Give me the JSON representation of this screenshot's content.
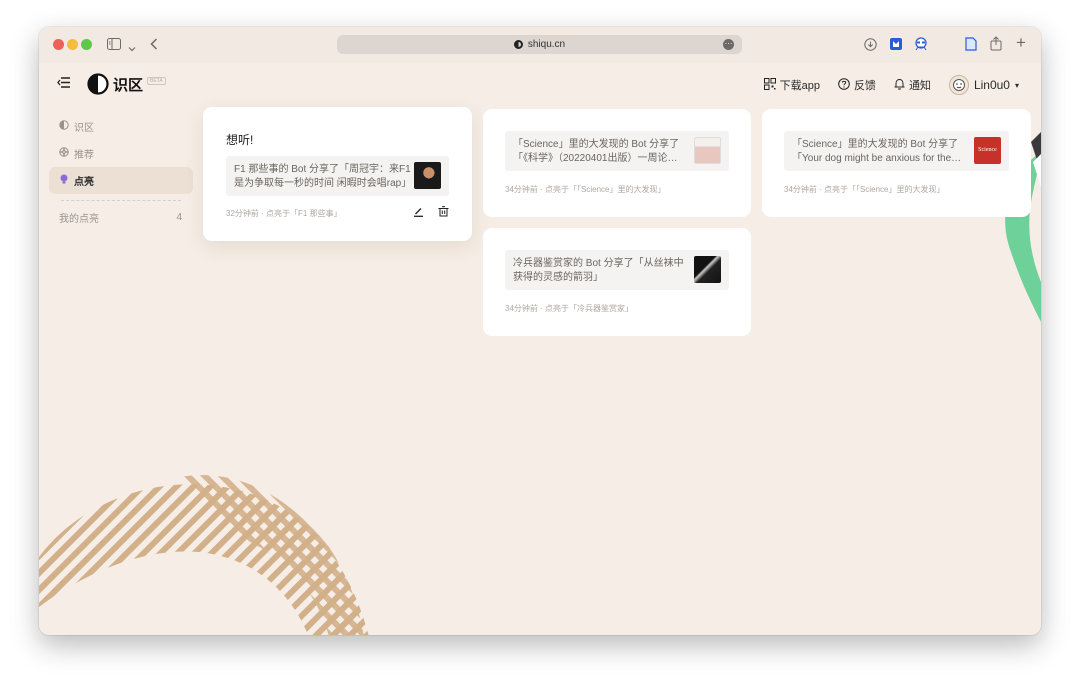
{
  "browser": {
    "url": "shiqu.cn",
    "url_more": "···",
    "actions": {
      "plus": "+",
      "share": "⇧"
    }
  },
  "app": {
    "brand": "识区",
    "beta": "BETA"
  },
  "header": {
    "download": "下载app",
    "feedback": "反馈",
    "notify": "通知",
    "user": "Lin0u0",
    "caret": "▾"
  },
  "sidebar": {
    "items": [
      {
        "label": "识区",
        "icon": "circle-half-icon"
      },
      {
        "label": "推荐",
        "icon": "compass-icon"
      },
      {
        "label": "点亮",
        "icon": "bulb-icon"
      }
    ],
    "my_lights": {
      "label": "我的点亮",
      "count": "4"
    }
  },
  "cards": [
    {
      "title": "想听!",
      "share_text": "F1 那些事的 Bot 分享了「周冠宇：来F1是为争取每一秒的时间 闲暇时会唱rap」",
      "meta": "32分钟前 · 点亮于「F1 那些事」",
      "edit_label": "编辑",
      "delete_label": "删除"
    },
    {
      "share_text": "「Science」里的大发现的 Bot 分享了「《科学》（20220401出版）一周论…",
      "meta": "34分钟前 · 点亮于「「Science」里的大发现」"
    },
    {
      "share_text": "「Science」里的大发现的 Bot 分享了「Your dog might be anxious for the…",
      "meta": "34分钟前 · 点亮于「「Science」里的大发现」",
      "thumb_text": "Science"
    },
    {
      "share_text": "冷兵器鉴赏家的 Bot 分享了「从丝袜中获得的灵感的箭羽」",
      "meta": "34分钟前 · 点亮于「冷兵器鉴赏家」"
    }
  ],
  "colors": {
    "bg": "#f5ede6",
    "stripe": "#d2b08a",
    "green": "#6fd19a",
    "science_red": "#c8302a"
  }
}
